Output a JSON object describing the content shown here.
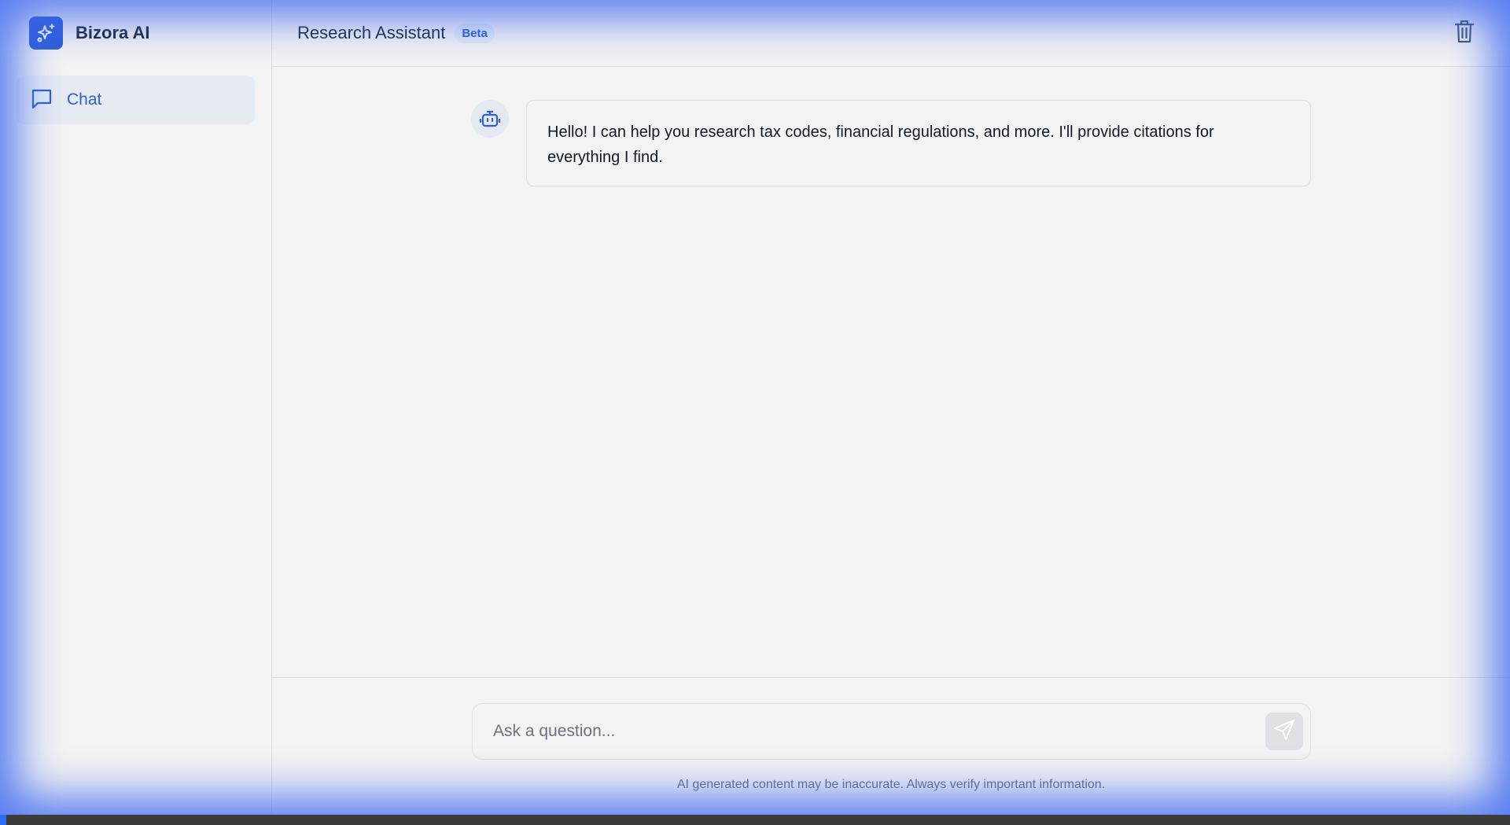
{
  "brand": {
    "name": "Bizora AI"
  },
  "sidebar": {
    "items": [
      {
        "label": "Chat",
        "active": true
      }
    ]
  },
  "header": {
    "title": "Research Assistant",
    "badge": "Beta"
  },
  "messages": [
    {
      "role": "assistant",
      "text": "Hello! I can help you research tax codes, financial regulations, and more. I'll provide citations for everything I find."
    }
  ],
  "composer": {
    "placeholder": "Ask a question...",
    "value": ""
  },
  "disclaimer": "AI generated content may be inaccurate. Always verify important information.",
  "colors": {
    "accent": "#2f5fd6",
    "glow": "#3b66f0"
  },
  "icons": {
    "brand": "sparkles-icon",
    "chat": "chat-bubble-icon",
    "clear": "trash-icon",
    "bot": "robot-icon",
    "send": "send-icon"
  }
}
